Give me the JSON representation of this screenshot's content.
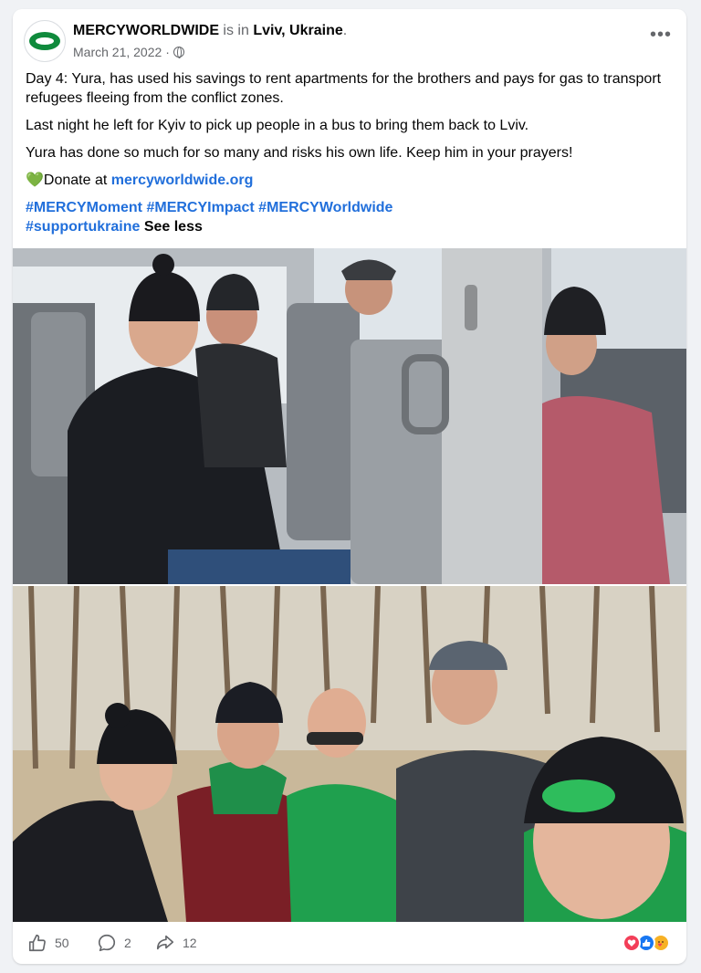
{
  "post": {
    "author": "MERCYWORLDWIDE",
    "verb": " is in ",
    "location": "Lviv, Ukraine",
    "period": ".",
    "date": "March 21, 2022",
    "date_sep": " · ",
    "paragraphs": [
      "Day 4: Yura, has used his savings to rent apartments for the brothers and pays for gas to transport refugees fleeing from the conflict zones.",
      "Last night he left for Kyiv to pick up people in a bus to bring them back to Lviv.",
      "Yura has done so much for so many and risks his own life. Keep him in your prayers!"
    ],
    "donate_emoji": "💚",
    "donate_prefix": "Donate at ",
    "donate_link": "mercyworldwide.org",
    "hashtags": [
      "#MERCYMoment",
      "#MERCYImpact",
      "#MERCYWorldwide",
      "#supportukraine"
    ],
    "see_less": "See less"
  },
  "footer": {
    "like_count": "50",
    "comment_count": "2",
    "share_count": "12"
  },
  "colors": {
    "link": "#216fdb",
    "secondary_text": "#65676b",
    "brand_green": "#0f8a3c"
  }
}
